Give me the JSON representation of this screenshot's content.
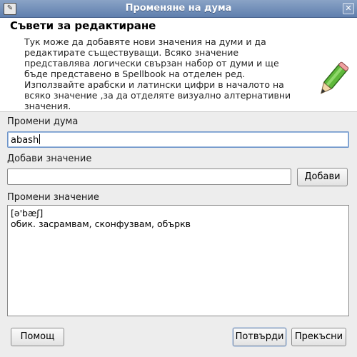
{
  "window": {
    "title": "Променяне на дума"
  },
  "header": {
    "title": "Съвети за редактиране",
    "description": "Тук може да добавяте нови значения на думи и да\nредактирате съществуващи. Всяко значение\nпредставлява логически свързан набор от думи и ще\nбъде представено в Spellbook на отделен ред.\nИзползвайте арабски и латински цифри в началото на\nвсяко значение ,за да отделяте визуално алтернативни\nзначения."
  },
  "edit_word": {
    "label": "Промени дума",
    "value": "abash"
  },
  "add_meaning": {
    "label": "Добави значение",
    "value": "",
    "button": "Добави"
  },
  "edit_meaning": {
    "label": "Промени значение",
    "lines": [
      "[ə'bæʃ]",
      "обик. засрамвам, сконфузвам, объркв"
    ]
  },
  "buttons": {
    "help": "Помощ",
    "confirm": "Потвърди",
    "cancel": "Прекъсни"
  },
  "icons": {
    "window": "dictionary-icon",
    "close": "close-icon",
    "header": "pencil-icon"
  }
}
